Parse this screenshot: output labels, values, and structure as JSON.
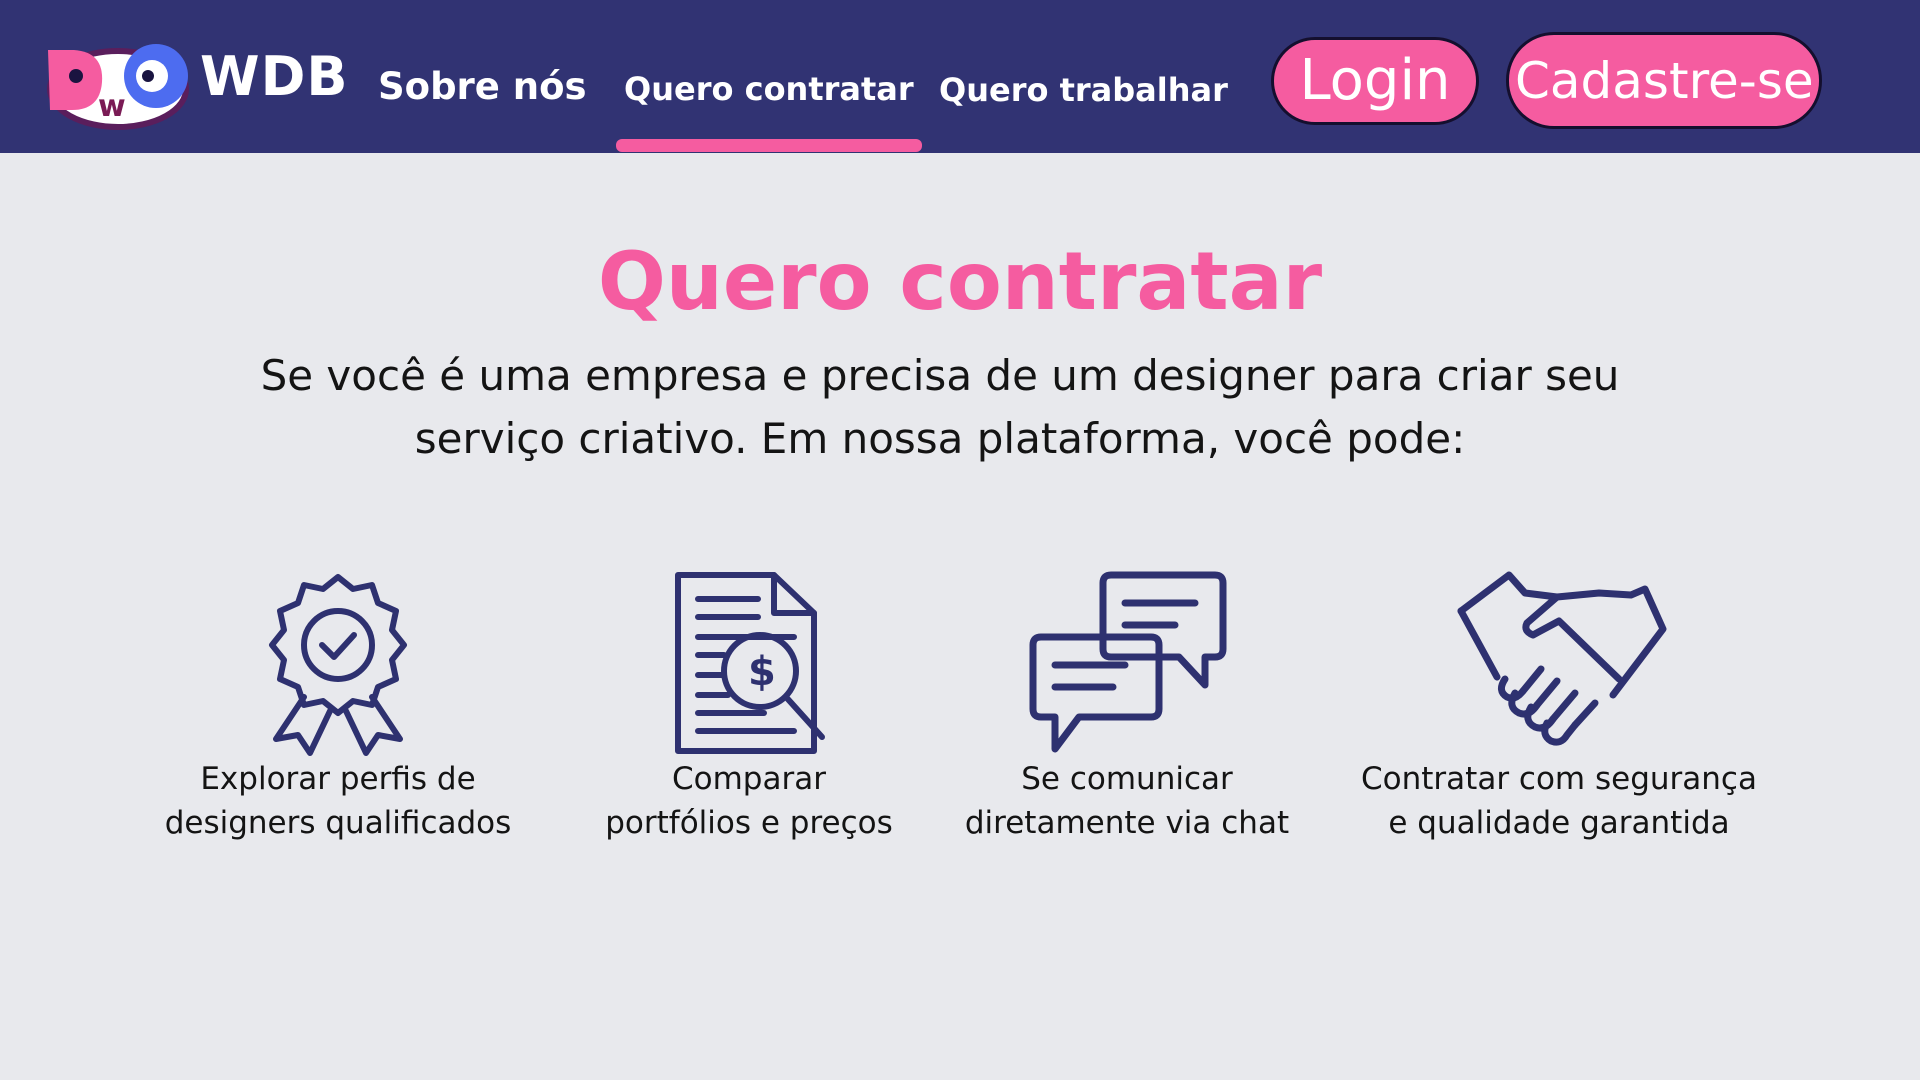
{
  "header": {
    "brand": "WDB",
    "logo_letters": {
      "left": "D",
      "middle": "w",
      "right": "O"
    },
    "nav": [
      {
        "label": "Sobre nós",
        "active": false
      },
      {
        "label": "Quero contratar",
        "active": true
      },
      {
        "label": "Quero trabalhar",
        "active": false
      }
    ],
    "login_label": "Login",
    "signup_label": "Cadastre-se"
  },
  "main": {
    "title": "Quero contratar",
    "intro": "Se você é uma empresa e precisa de um designer para criar seu serviço criativo. Em nossa plataforma, você pode:",
    "features": [
      {
        "icon": "award-badge-icon",
        "label": "Explorar perfis de\ndesigners qualificados"
      },
      {
        "icon": "document-price-search-icon",
        "label": "Comparar\nportfólios e preços"
      },
      {
        "icon": "chat-bubbles-icon",
        "label": "Se comunicar\ndiretamente via chat"
      },
      {
        "icon": "handshake-icon",
        "label": "Contratar com segurança\ne qualidade garantida"
      }
    ]
  },
  "colors": {
    "navbar": "#313373",
    "accent": "#f55ca0",
    "background": "#e8e9ed",
    "icon_stroke": "#2e3170",
    "text": "#141414"
  }
}
